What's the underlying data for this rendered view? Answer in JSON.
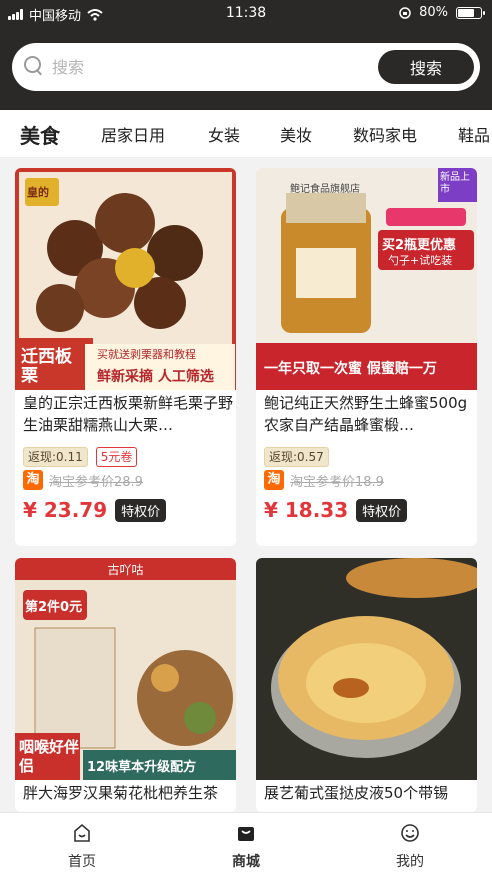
{
  "status_bar": {
    "carrier": "中国移动",
    "time": "11:38",
    "battery": "80%",
    "battery_level": 0.8
  },
  "search": {
    "placeholder": "搜索",
    "button_label": "搜索"
  },
  "categories": [
    "美食",
    "居家日用",
    "女装",
    "美妆",
    "数码家电",
    "鞋品"
  ],
  "active_category": "美食",
  "products": [
    {
      "image": {
        "brand": "皇的",
        "title": "迁西板栗",
        "caption": "鲜新采摘 人工筛选",
        "note": "买就送剥栗器和教程",
        "colors": [
          "#6b3a1f",
          "#d63b2b"
        ]
      },
      "title": "皇的正宗迁西板栗新鲜毛栗子野生油栗甜糯燕山大栗…",
      "rebate": "返现:0.11",
      "coupon": "5元卷",
      "taobao_ref": "淘宝参考价28.9",
      "price": "¥ 23.79",
      "price_tag": "特权价"
    },
    {
      "image": {
        "brand": "鲍记食品旗舰店",
        "title": "买2瓶更优惠",
        "subtitle": "勺子+试吃装",
        "caption": "一年只取一次蜜 假蜜赔一万",
        "corner": "新品上市",
        "colors": [
          "#f0e6d8",
          "#c8252c"
        ]
      },
      "title": "鲍记纯正天然野生土蜂蜜500g农家自产结晶蜂蜜椴…",
      "rebate": "返现:0.57",
      "coupon": "",
      "taobao_ref": "淘宝参考价18.9",
      "price": "¥ 18.33",
      "price_tag": "特权价"
    },
    {
      "image": {
        "brand": "古吖咕",
        "title": "第2件0元",
        "subtitle": "12味草本升级配方",
        "caption": "咽喉好伴侣",
        "colors": [
          "#c9302c",
          "#e8dccb"
        ]
      },
      "title": "胖大海罗汉果菊花枇杷养生茶"
    },
    {
      "image": {
        "colors": [
          "#3a3a30",
          "#e0a850"
        ]
      },
      "title": "展艺葡式蛋挞皮液50个带锡"
    }
  ],
  "bottom_nav": [
    {
      "label": "首页",
      "icon": "home-icon"
    },
    {
      "label": "商城",
      "icon": "shop-bag-icon"
    },
    {
      "label": "我的",
      "icon": "profile-icon"
    }
  ],
  "active_nav": "商城"
}
